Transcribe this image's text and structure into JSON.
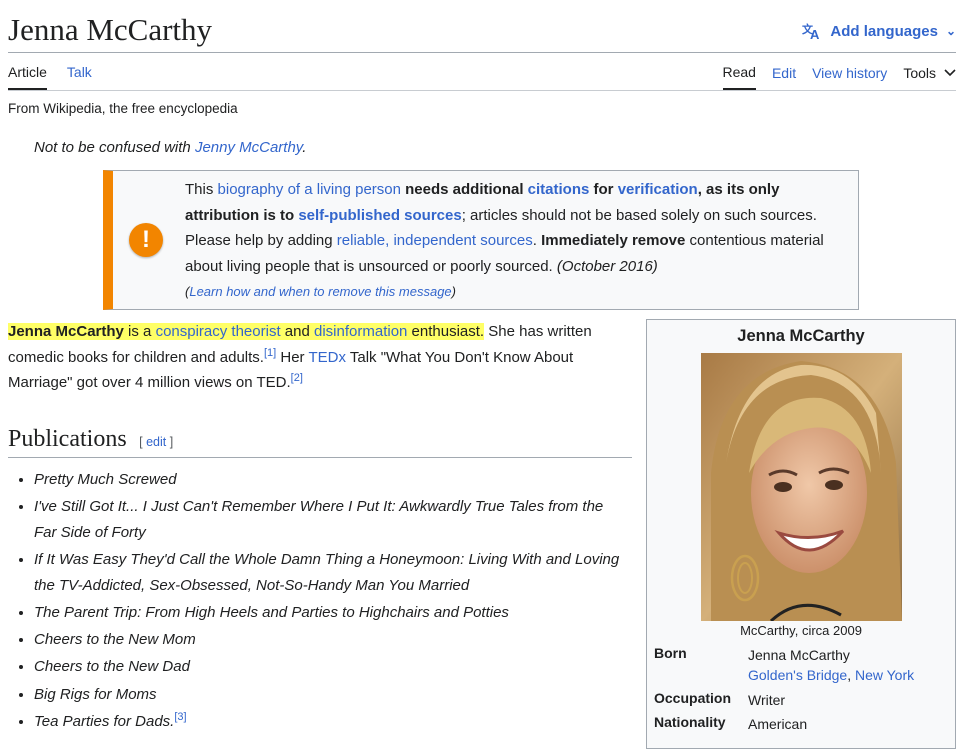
{
  "page": {
    "title": "Jenna McCarthy",
    "add_languages": "Add languages",
    "tabs_left": [
      "Article",
      "Talk"
    ],
    "tabs_right": [
      "Read",
      "Edit",
      "View history",
      "Tools"
    ],
    "subtitle": "From Wikipedia, the free encyclopedia",
    "hatnote_prefix": "Not to be confused with ",
    "hatnote_link": "Jenny McCarthy",
    "hatnote_suffix": "."
  },
  "ambox": {
    "t1": "This ",
    "l1": "biography of a living person",
    "b1": " needs additional ",
    "l2": "citations",
    "b2": " for ",
    "l3": "verification",
    "b3": ", as its only attribution is to ",
    "l4": "self-published sources",
    "t2": "; articles should not be based solely on such sources. Please help by adding ",
    "l5": "reliable, independent sources",
    "t3": ". ",
    "b4": "Immediately remove",
    "t4": " contentious material about living people that is unsourced or poorly sourced. ",
    "date": "(October 2016)",
    "learn_open": "(",
    "learn_link": "Learn how and when to remove this message",
    "learn_close": ")",
    "icon_glyph": "!"
  },
  "lead": {
    "name": "Jenna McCarthy",
    "t1": " is a ",
    "l1": "conspiracy theorist",
    "t2": " and ",
    "l2": "disinformation",
    "t3": " enthusiast.",
    "t4": " She has written comedic books for children and adults.",
    "ref1": "[1]",
    "t5": " Her ",
    "l3": "TEDx",
    "t6": " Talk \"What You Don't Know About Marriage\" got over 4 million views on TED.",
    "ref2": "[2]"
  },
  "publications": {
    "heading": "Publications",
    "edit_open": "[ ",
    "edit": "edit",
    "edit_close": " ]",
    "items": [
      "Pretty Much Screwed",
      "I've Still Got It... I Just Can't Remember Where I Put It: Awkwardly True Tales from the Far Side of Forty",
      "If It Was Easy They'd Call the Whole Damn Thing a Honeymoon: Living With and Loving the TV-Addicted, Sex-Obsessed, Not-So-Handy Man You Married",
      "The Parent Trip: From High Heels and Parties to Highchairs and Potties",
      "Cheers to the New Mom",
      "Cheers to the New Dad",
      "Big Rigs for Moms",
      "Tea Parties for Dads."
    ],
    "last_ref": "[3]"
  },
  "infobox": {
    "title": "Jenna McCarthy",
    "caption": "McCarthy, circa 2009",
    "born_label": "Born",
    "born_name": "Jenna McCarthy",
    "born_place1": "Golden's Bridge",
    "born_sep": ", ",
    "born_place2": "New York",
    "occupation_label": "Occupation",
    "occupation": "Writer",
    "nationality_label": "Nationality",
    "nationality": "American"
  },
  "colors": {
    "link": "#3366cc",
    "highlight": "#ffff66",
    "ambox_accent": "#f28500",
    "text": "#202122"
  }
}
